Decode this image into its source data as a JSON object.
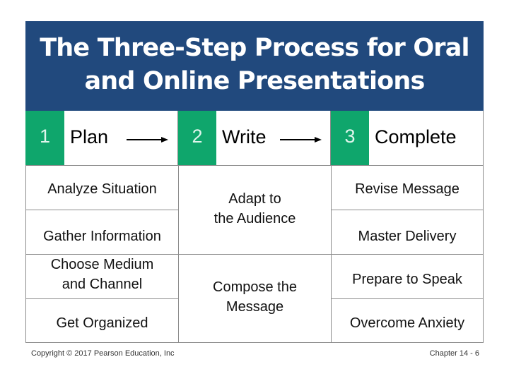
{
  "slide": {
    "title": "The Three-Step Process for Oral\nand Online Presentations",
    "colors": {
      "header_bg": "#21497d",
      "step_accent": "#0fa66c",
      "border": "#8c8c8c"
    }
  },
  "steps": [
    {
      "number": "1",
      "label": "Plan"
    },
    {
      "number": "2",
      "label": "Write"
    },
    {
      "number": "3",
      "label": "Complete"
    }
  ],
  "columns": {
    "plan": [
      "Analyze Situation",
      "Gather Information",
      "Choose Medium\nand Channel",
      "Get Organized"
    ],
    "write": [
      "Adapt to\nthe Audience",
      "Compose the\nMessage"
    ],
    "complete": [
      "Revise Message",
      "Master Delivery",
      "Prepare to Speak",
      "Overcome Anxiety"
    ]
  },
  "footer": {
    "copyright": "Copyright © 2017 Pearson Education, Inc",
    "page": "Chapter 14 - 6"
  }
}
